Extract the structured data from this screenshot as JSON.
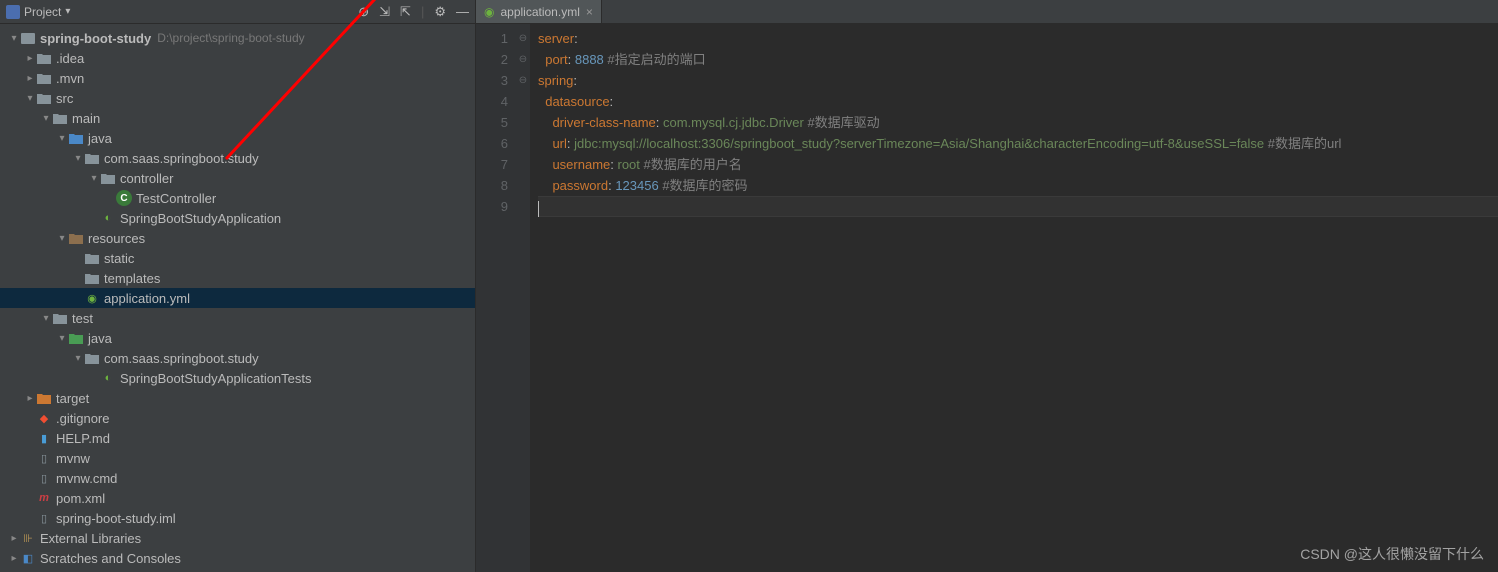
{
  "header": {
    "title": "Project"
  },
  "project": {
    "root": "spring-boot-study",
    "rootPath": "D:\\project\\spring-boot-study"
  },
  "tree": {
    "idea": ".idea",
    "mvn": ".mvn",
    "src": "src",
    "main": "main",
    "java": "java",
    "pkg": "com.saas.springboot.study",
    "controller": "controller",
    "testController": "TestController",
    "springApp": "SpringBootStudyApplication",
    "resources": "resources",
    "static": "static",
    "templates": "templates",
    "appYml": "application.yml",
    "test": "test",
    "testJava": "java",
    "testPkg": "com.saas.springboot.study",
    "springAppTests": "SpringBootStudyApplicationTests",
    "target": "target",
    "gitignore": ".gitignore",
    "help": "HELP.md",
    "mvnw": "mvnw",
    "mvnwCmd": "mvnw.cmd",
    "pom": "pom.xml",
    "iml": "spring-boot-study.iml",
    "extLib": "External Libraries",
    "scratches": "Scratches and Consoles"
  },
  "tab": {
    "label": "application.yml"
  },
  "code": {
    "lines": [
      {
        "n": "1",
        "raw": [
          {
            "t": "server",
            "c": "key"
          },
          {
            "t": ":",
            "c": ""
          }
        ]
      },
      {
        "n": "2",
        "raw": [
          {
            "t": "  port",
            "c": "key"
          },
          {
            "t": ": ",
            "c": ""
          },
          {
            "t": "8888",
            "c": "num"
          },
          {
            "t": " #指定启动的端口",
            "c": "comment"
          }
        ]
      },
      {
        "n": "3",
        "raw": [
          {
            "t": "spring",
            "c": "key"
          },
          {
            "t": ":",
            "c": ""
          }
        ]
      },
      {
        "n": "4",
        "raw": [
          {
            "t": "  datasource",
            "c": "key"
          },
          {
            "t": ":",
            "c": ""
          }
        ]
      },
      {
        "n": "5",
        "raw": [
          {
            "t": "    driver-class-name",
            "c": "key"
          },
          {
            "t": ": ",
            "c": ""
          },
          {
            "t": "com.mysql.cj.jdbc.Driver",
            "c": "val"
          },
          {
            "t": " #数据库驱动",
            "c": "comment"
          }
        ]
      },
      {
        "n": "6",
        "raw": [
          {
            "t": "    url",
            "c": "key"
          },
          {
            "t": ": ",
            "c": ""
          },
          {
            "t": "jdbc:mysql://localhost:3306/springboot_study?serverTimezone=Asia/Shanghai&characterEncoding=utf-8&useSSL=false",
            "c": "val"
          },
          {
            "t": " #数据库的url",
            "c": "comment"
          }
        ]
      },
      {
        "n": "7",
        "raw": [
          {
            "t": "    username",
            "c": "key"
          },
          {
            "t": ": ",
            "c": ""
          },
          {
            "t": "root",
            "c": "val"
          },
          {
            "t": " #数据库的用户名",
            "c": "comment"
          }
        ]
      },
      {
        "n": "8",
        "raw": [
          {
            "t": "    password",
            "c": "key"
          },
          {
            "t": ": ",
            "c": ""
          },
          {
            "t": "123456",
            "c": "num"
          },
          {
            "t": " #数据库的密码",
            "c": "comment"
          }
        ]
      },
      {
        "n": "9",
        "raw": []
      }
    ]
  },
  "watermark": "CSDN @这人很懒没留下什么"
}
